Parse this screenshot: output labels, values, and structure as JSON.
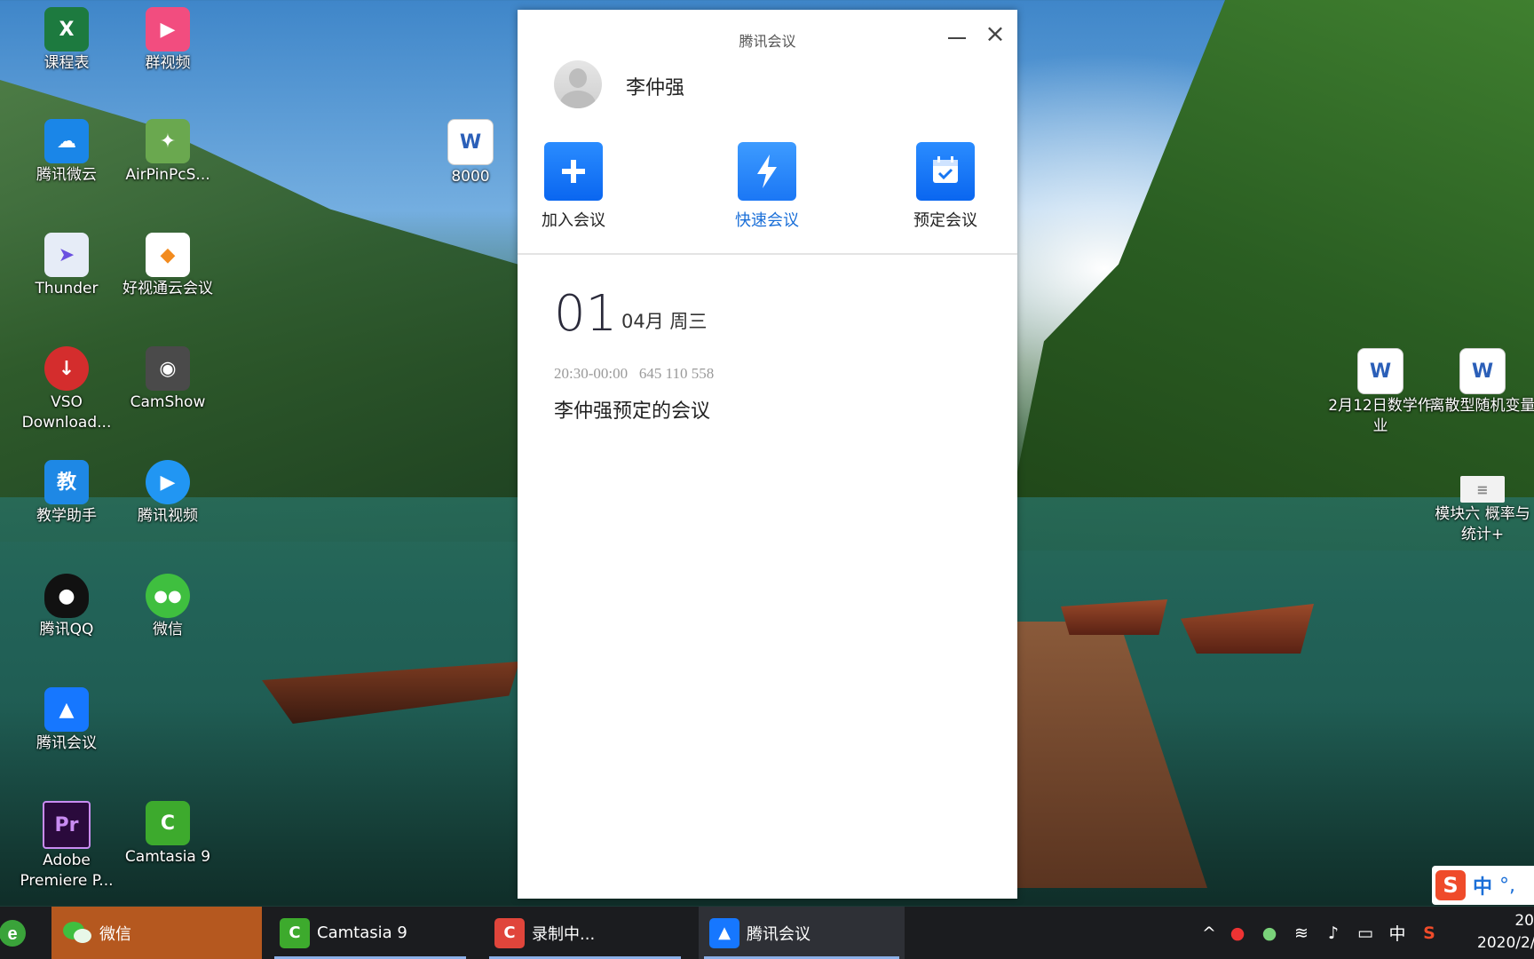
{
  "desktop": {
    "icons": [
      {
        "label": "课程表",
        "icon": "excel-icon",
        "color": "#1d7a3f",
        "glyph": "X"
      },
      {
        "label": "群视频",
        "icon": "group-video-icon",
        "color": "#f24d7f",
        "glyph": "▶"
      },
      {
        "label": "腾讯微云",
        "icon": "weiyun-cloud-icon",
        "color": "#1a86e8",
        "glyph": "☁"
      },
      {
        "label": "AirPinPcS...",
        "icon": "airpin-icon",
        "color": "#6aa84f",
        "glyph": "✦"
      },
      {
        "label": "8000",
        "icon": "word-doc-icon",
        "color": "#2b5fb8",
        "glyph": "W"
      },
      {
        "label": "Thunder",
        "icon": "thunder-icon",
        "color": "#e6ecf7",
        "glyph": "➤"
      },
      {
        "label": "好视通云会议",
        "icon": "haoshitong-icon",
        "color": "#ffffff",
        "glyph": "◆"
      },
      {
        "label": "VSO Download...",
        "icon": "vso-download-icon",
        "color": "#d42d2d",
        "glyph": "↓"
      },
      {
        "label": "CamShow",
        "icon": "camshow-icon",
        "color": "#4a4a4a",
        "glyph": "◉"
      },
      {
        "label": "教学助手",
        "icon": "teaching-assistant-icon",
        "color": "#1e88e5",
        "glyph": "教"
      },
      {
        "label": "腾讯视频",
        "icon": "tencent-video-icon",
        "color": "#2196f3",
        "glyph": "▶"
      },
      {
        "label": "腾讯QQ",
        "icon": "qq-penguin-icon",
        "color": "#111111",
        "glyph": "●"
      },
      {
        "label": "微信",
        "icon": "wechat-icon",
        "color": "#3fbf3f",
        "glyph": "💬"
      },
      {
        "label": "腾讯会议",
        "icon": "tencent-meeting-icon",
        "color": "#1677ff",
        "glyph": "▲"
      },
      {
        "label": "Adobe Premiere P...",
        "icon": "premiere-icon",
        "color": "#2a0a3c",
        "glyph": "Pr"
      },
      {
        "label": "Camtasia 9",
        "icon": "camtasia-icon",
        "color": "#3daa2d",
        "glyph": "C"
      },
      {
        "label": "2月12日数学作业",
        "icon": "word-doc-icon",
        "color": "#2b5fb8",
        "glyph": "W"
      },
      {
        "label": "离散型随机变量",
        "icon": "word-doc-icon",
        "color": "#2b5fb8",
        "glyph": "W"
      },
      {
        "label": "模块六 概率与统计+",
        "icon": "document-thumbnail-icon",
        "color": "#f2f2f2",
        "glyph": "≡"
      }
    ]
  },
  "dialog": {
    "title": "腾讯会议",
    "user_name": "李仲强",
    "actions": [
      {
        "label": "加入会议",
        "icon": "plus-icon"
      },
      {
        "label": "快速会议",
        "icon": "lightning-icon"
      },
      {
        "label": "预定会议",
        "icon": "calendar-icon"
      }
    ],
    "date_day": "01",
    "date_rest": "04月  周三",
    "meeting_time": "20:30-00:00",
    "meeting_id": "645 110 558",
    "meeting_title": "李仲强预定的会议"
  },
  "taskbar": {
    "items": [
      {
        "label": "微信",
        "icon": "wechat-icon"
      },
      {
        "label": "Camtasia 9",
        "icon": "camtasia-icon"
      },
      {
        "label": "录制中...",
        "icon": "recording-icon"
      },
      {
        "label": "腾讯会议",
        "icon": "tencent-meeting-icon"
      }
    ],
    "tray_ime": "中",
    "clock_time": "20",
    "clock_date": "2020/2/"
  },
  "ime_bar": {
    "logo": "S",
    "mode": "中",
    "punct": "°,"
  }
}
